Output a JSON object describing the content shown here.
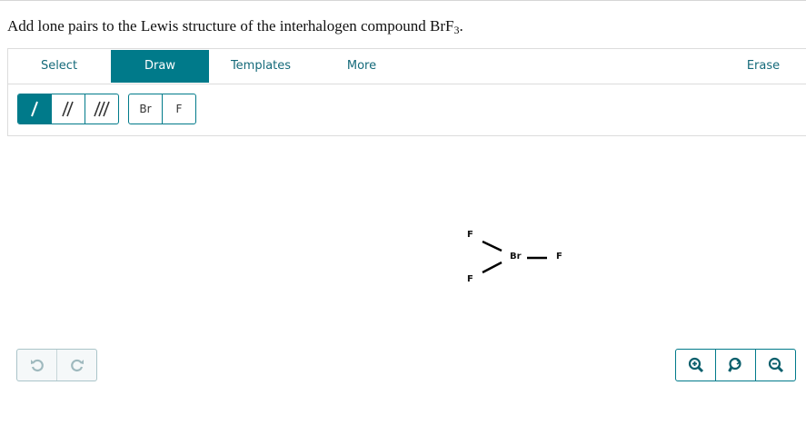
{
  "question": {
    "text": "Add lone pairs to the Lewis structure of the interhalogen compound BrF",
    "subscript": "3",
    "suffix": "."
  },
  "toolbar": {
    "tabs": [
      {
        "label": "Select",
        "active": false
      },
      {
        "label": "Draw",
        "active": true
      },
      {
        "label": "Templates",
        "active": false
      },
      {
        "label": "More",
        "active": false
      }
    ],
    "erase_label": "Erase"
  },
  "subtoolbar": {
    "bond_tools": [
      "single-bond-icon",
      "double-bond-icon",
      "triple-bond-icon"
    ],
    "active_bond": "single-bond-icon",
    "atoms": [
      "Br",
      "F"
    ]
  },
  "molecule": {
    "atoms": [
      "F",
      "Br",
      "F",
      "F"
    ]
  },
  "controls": {
    "undo_icons": [
      "undo-icon",
      "redo-icon"
    ],
    "zoom_icons": [
      "zoom-in-icon",
      "reset-zoom-icon",
      "zoom-out-icon"
    ]
  },
  "colors": {
    "accent": "#007a8a",
    "accent_text": "#156a7a",
    "border": "#dcdcdc"
  }
}
